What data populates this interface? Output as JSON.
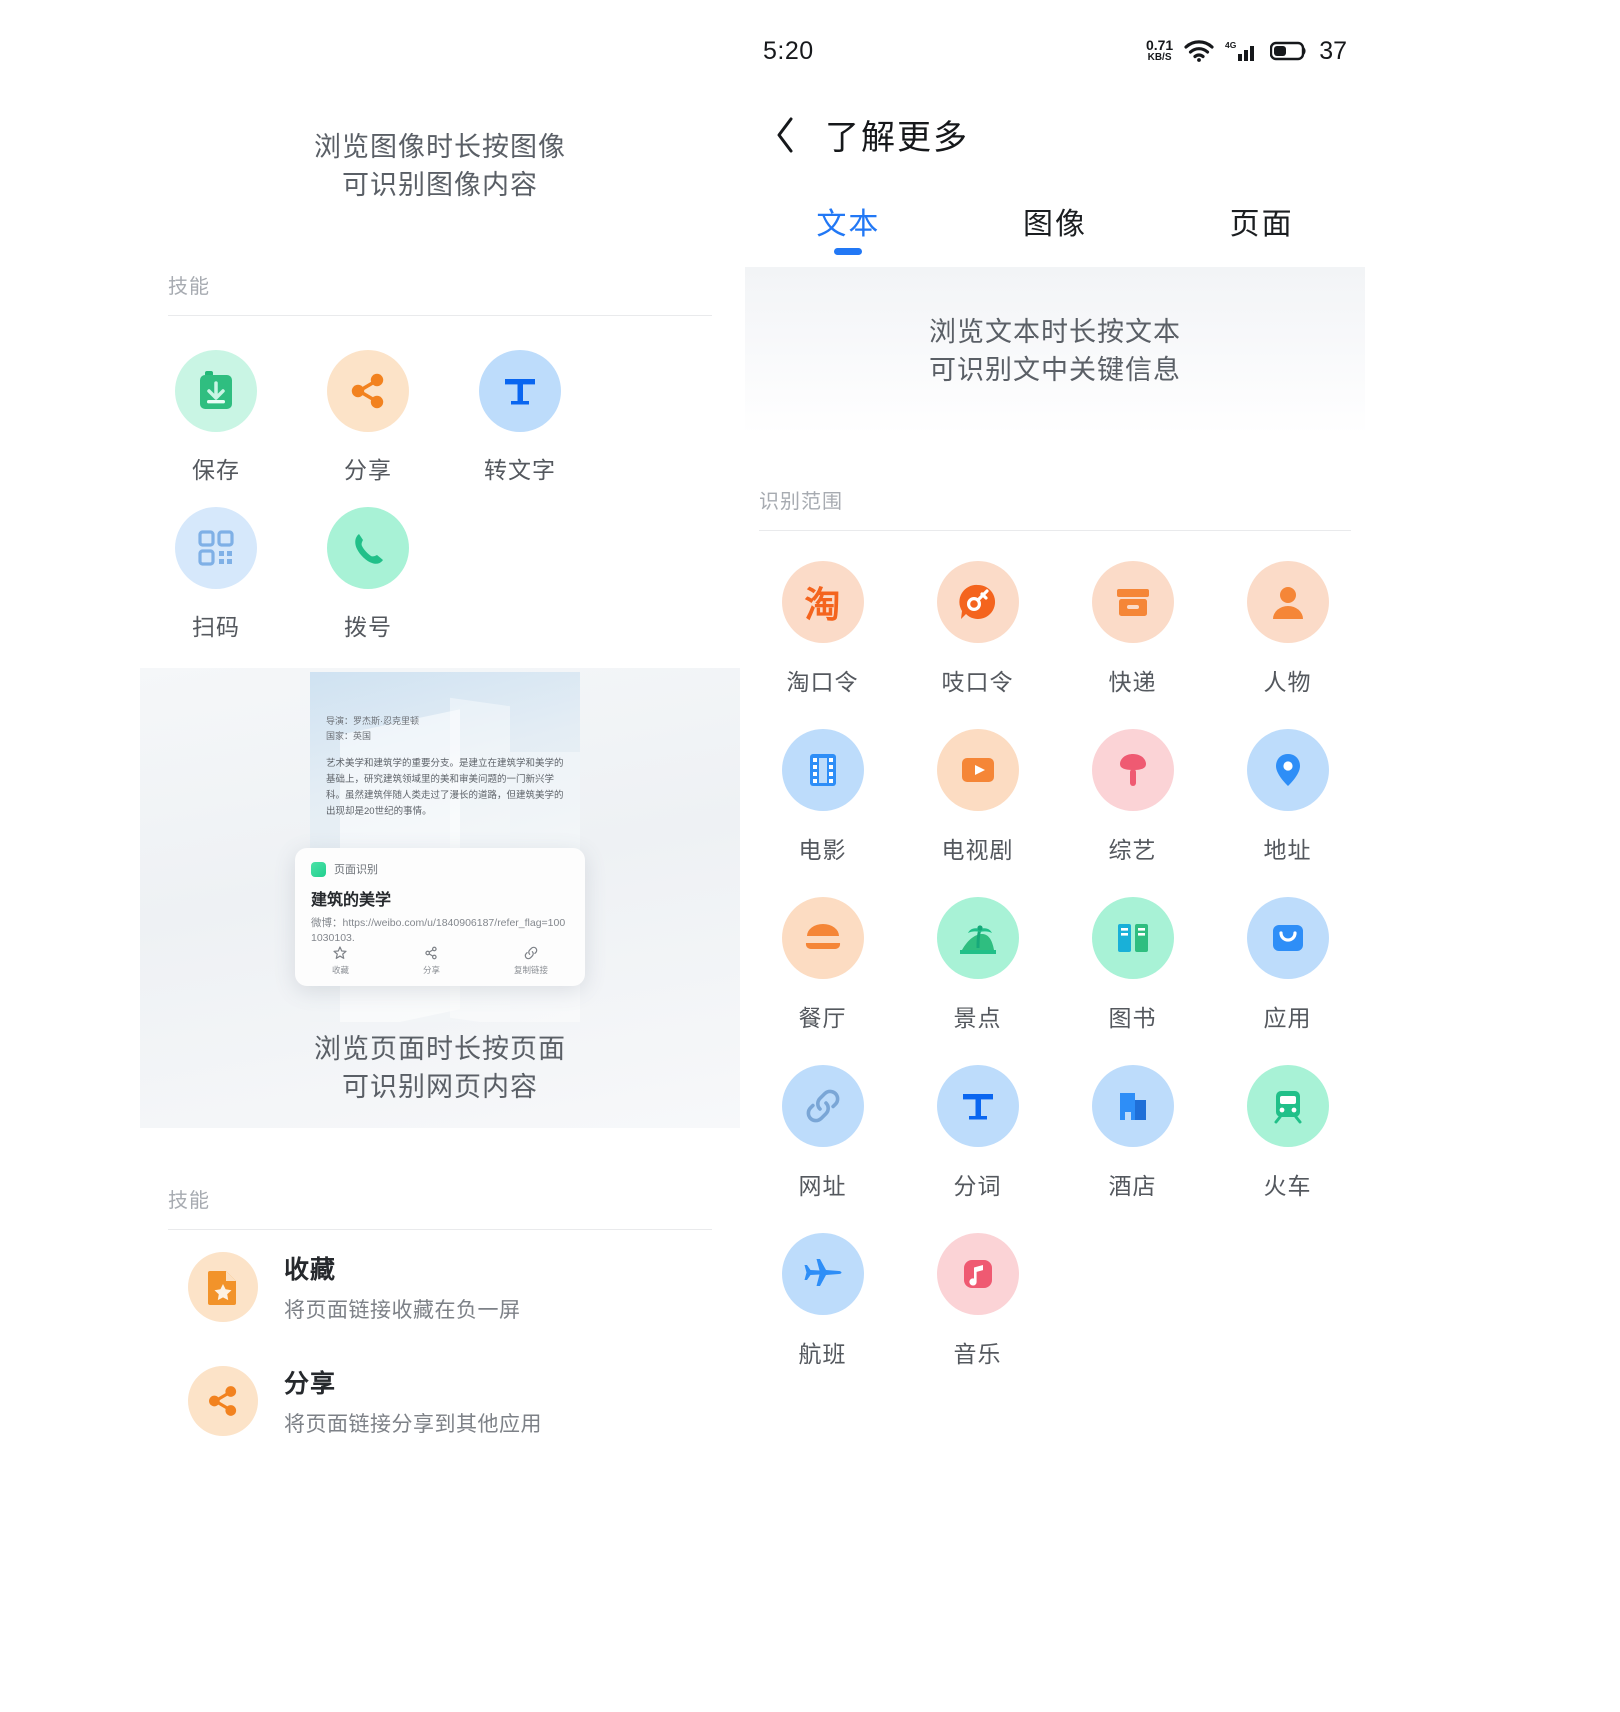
{
  "left": {
    "hero": {
      "line1": "浏览图像时长按图像",
      "line2": "可识别图像内容"
    },
    "skills_label": "技能",
    "skills": [
      {
        "label": "保存",
        "icon": "save-icon",
        "bg": "#c9f5e4",
        "fg": "#22b877"
      },
      {
        "label": "分享",
        "icon": "share-icon",
        "bg": "#fce3c8",
        "fg": "#f2821f"
      },
      {
        "label": "转文字",
        "icon": "text-convert-icon",
        "bg": "#bddcfb",
        "fg": "#0a66f0"
      },
      {
        "label": "扫码",
        "icon": "qr-scan-icon",
        "bg": "#d6e8fb",
        "fg": "#6fa8e8"
      },
      {
        "label": "拨号",
        "icon": "phone-icon",
        "bg": "#a8f2d6",
        "fg": "#21c089"
      }
    ],
    "preview": {
      "meta_line1": "导演：罗杰斯·忍克里顿",
      "meta_line2": "国家：英国",
      "body": "艺术美学和建筑学的重要分支。是建立在建筑学和美学的基础上，研究建筑领域里的美和审美问题的一门新兴学科。虽然建筑伴随人类走过了漫长的道路，但建筑美学的出现却是20世纪的事情。",
      "card": {
        "tag": "页面识别",
        "title": "建筑的美学",
        "url": "微博：https://weibo.com/u/1840906187/refer_flag=1001030103.",
        "actions": [
          {
            "label": "收藏",
            "icon": "star-icon"
          },
          {
            "label": "分享",
            "icon": "share-icon"
          },
          {
            "label": "复制链接",
            "icon": "link-icon"
          }
        ]
      }
    },
    "hero2": {
      "line1": "浏览页面时长按页面",
      "line2": "可识别网页内容"
    },
    "skills2_label": "技能",
    "skills2": [
      {
        "title": "收藏",
        "sub": "将页面链接收藏在负一屏",
        "icon": "file-star-icon",
        "bg": "#fce3c8",
        "fg": "#f2932a"
      },
      {
        "title": "分享",
        "sub": "将页面链接分享到其他应用",
        "icon": "share-icon",
        "bg": "#fce3c8",
        "fg": "#f2821f"
      }
    ]
  },
  "right": {
    "statusbar": {
      "time": "5:20",
      "netspeed_value": "0.71",
      "netspeed_unit": "KB/S",
      "wifi": "wifi-icon",
      "signal": "signal-4g-icon",
      "battery_level": "37"
    },
    "nav": {
      "back": "back-chevron-icon",
      "title": "了解更多"
    },
    "tabs": [
      {
        "label": "文本",
        "active": true
      },
      {
        "label": "图像",
        "active": false
      },
      {
        "label": "页面",
        "active": false
      }
    ],
    "banner": {
      "line1": "浏览文本时长按文本",
      "line2": "可识别文中关键信息"
    },
    "scope_label": "识别范围",
    "scope": [
      {
        "label": "淘口令",
        "icon": "taobao-code-icon",
        "bg": "#fbdbc8",
        "fg": "#f4641e"
      },
      {
        "label": "吱口令",
        "icon": "alipay-code-icon",
        "bg": "#fbdbc8",
        "fg": "#f4641e"
      },
      {
        "label": "快递",
        "icon": "package-icon",
        "bg": "#fbdbc8",
        "fg": "#f58637"
      },
      {
        "label": "人物",
        "icon": "person-icon",
        "bg": "#fbdbc8",
        "fg": "#f58637"
      },
      {
        "label": "电影",
        "icon": "film-icon",
        "bg": "#bddcfb",
        "fg": "#2e8ef7"
      },
      {
        "label": "电视剧",
        "icon": "tv-play-icon",
        "bg": "#fcdcc2",
        "fg": "#f58637"
      },
      {
        "label": "综艺",
        "icon": "microphone-icon",
        "bg": "#fbd3d6",
        "fg": "#ef5a72"
      },
      {
        "label": "地址",
        "icon": "location-pin-icon",
        "bg": "#bddcfb",
        "fg": "#2e8ef7"
      },
      {
        "label": "餐厅",
        "icon": "burger-icon",
        "bg": "#fcdcc2",
        "fg": "#f58637"
      },
      {
        "label": "景点",
        "icon": "palm-tree-icon",
        "bg": "#a8f2d6",
        "fg": "#21c089"
      },
      {
        "label": "图书",
        "icon": "book-icon",
        "bg": "#a8f2d6",
        "fg": "#1fa7d8"
      },
      {
        "label": "应用",
        "icon": "app-store-icon",
        "bg": "#bddcfb",
        "fg": "#2e8ef7"
      },
      {
        "label": "网址",
        "icon": "link-icon",
        "bg": "#bddcfb",
        "fg": "#7aa6d6"
      },
      {
        "label": "分词",
        "icon": "text-segment-icon",
        "bg": "#bddcfb",
        "fg": "#0a66f0"
      },
      {
        "label": "酒店",
        "icon": "hotel-icon",
        "bg": "#bddcfb",
        "fg": "#2e8ef7"
      },
      {
        "label": "火车",
        "icon": "train-icon",
        "bg": "#a8f2d6",
        "fg": "#21c089"
      },
      {
        "label": "航班",
        "icon": "airplane-icon",
        "bg": "#bddcfb",
        "fg": "#2e8ef7"
      },
      {
        "label": "音乐",
        "icon": "music-note-icon",
        "bg": "#fbd3d6",
        "fg": "#ef5a72"
      }
    ]
  },
  "colors": {
    "accent": "#2278f5",
    "text_primary": "#26292d",
    "text_muted": "#7d8187"
  }
}
